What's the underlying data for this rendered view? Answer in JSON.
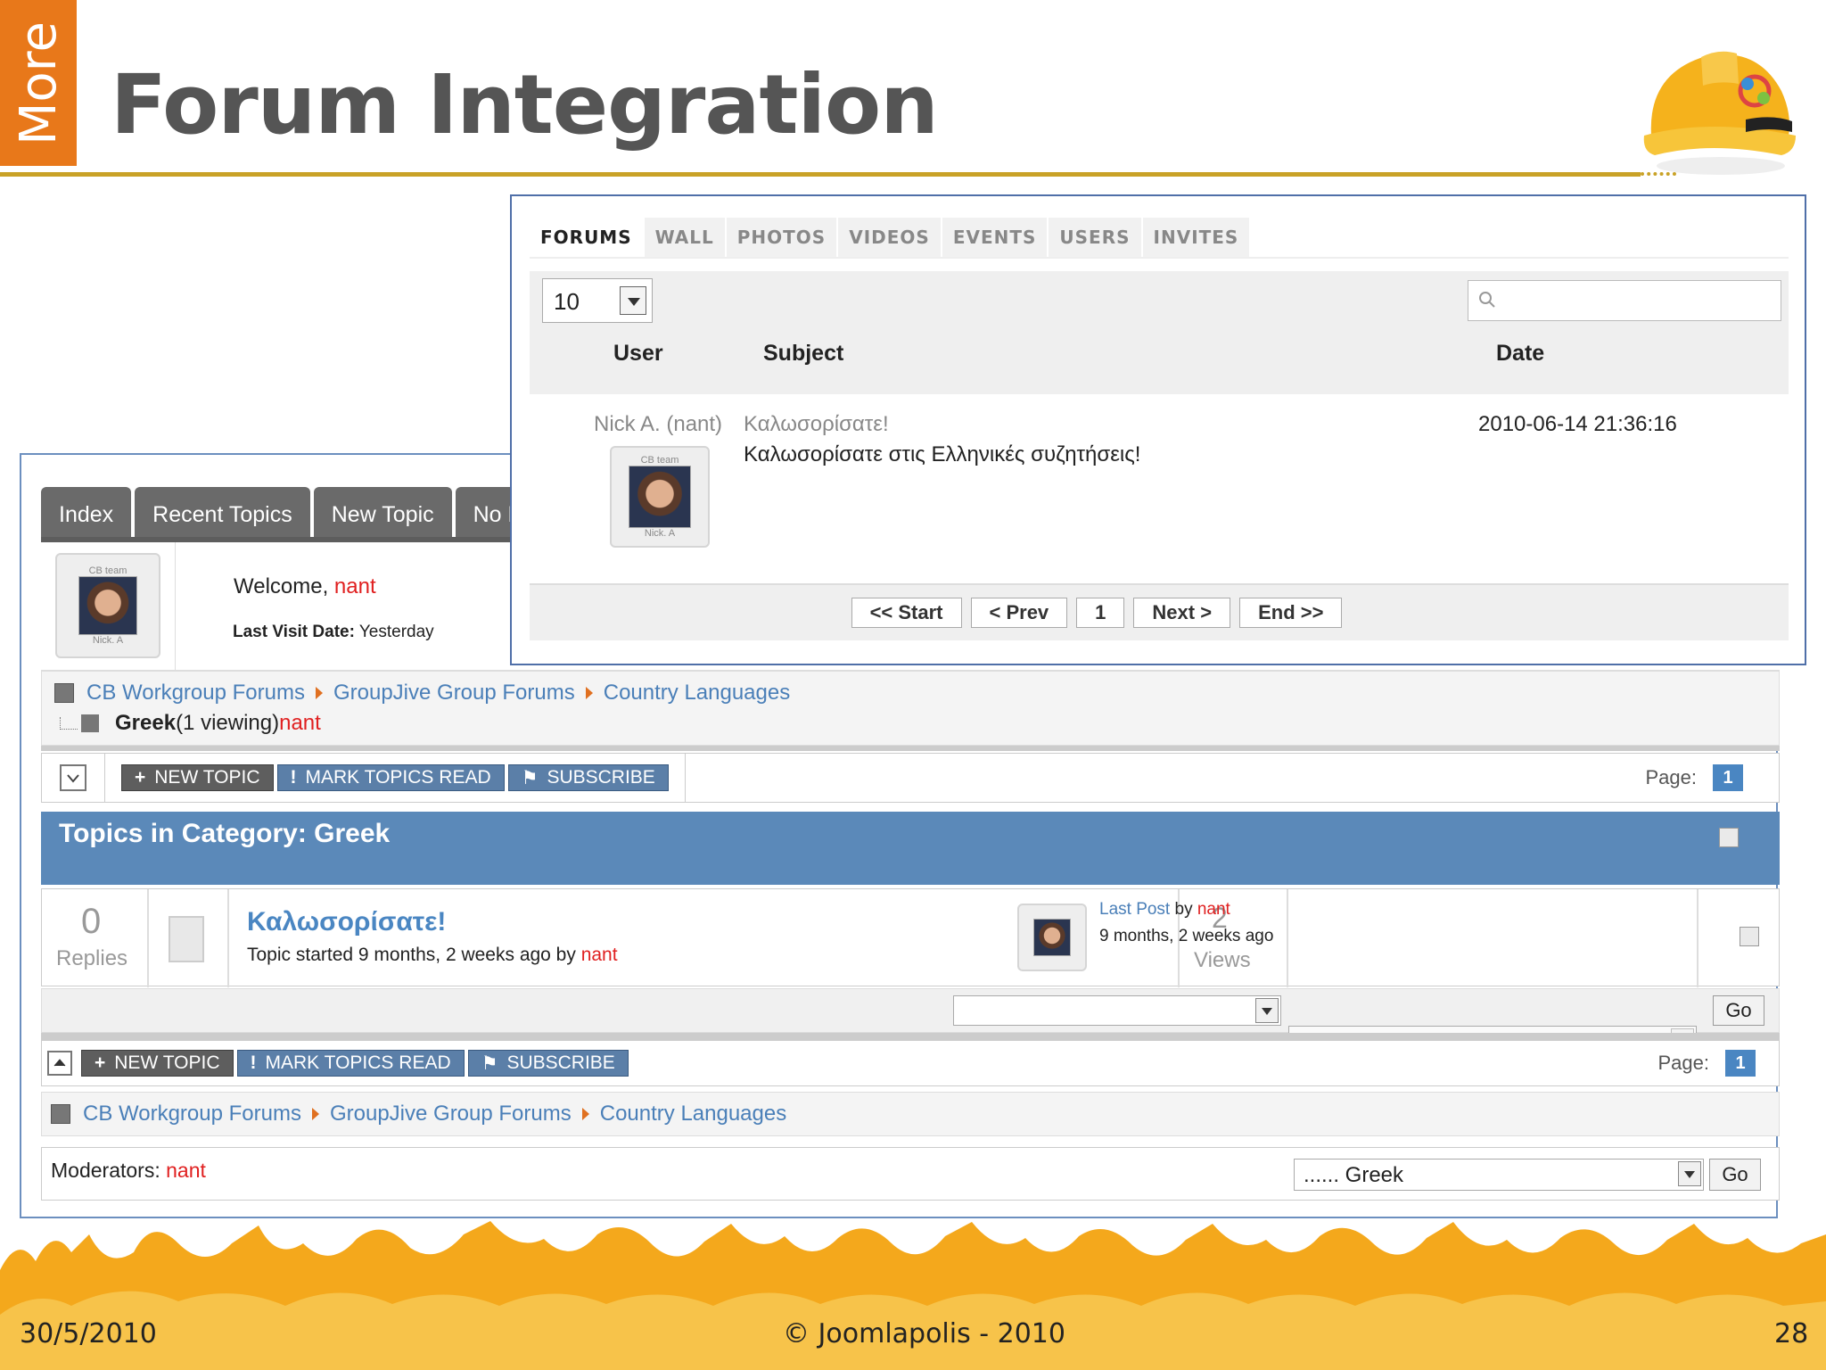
{
  "slide": {
    "side_tab": "More",
    "title": "Forum Integration",
    "footer_date": "30/5/2010",
    "footer_copyright": "© Joomlapolis - 2010",
    "footer_page": "28"
  },
  "forum": {
    "tabs": [
      "Index",
      "Recent Topics",
      "New Topic",
      "No F"
    ],
    "welcome_label": "Welcome, ",
    "welcome_user": "nant",
    "last_visit_label": "Last Visit Date:",
    "last_visit_value": " Yesterday",
    "avatar_caption": "Nick. A",
    "avatar_badge": "CB team",
    "breadcrumb": [
      "CB Workgroup Forums",
      "GroupJive Group Forums",
      "Country Languages"
    ],
    "current_forum": "Greek",
    "viewing": " (1 viewing) ",
    "viewing_user": "nant",
    "toolbar": {
      "new_topic": "NEW TOPIC",
      "mark_read": "MARK TOPICS READ",
      "subscribe": "SUBSCRIBE",
      "page_label": "Page:",
      "page_num": "1"
    },
    "category_header": "Topics in Category: Greek",
    "topic": {
      "replies": "0",
      "replies_label": "Replies",
      "title": "Καλωσορίσατε!",
      "meta": "Topic started 9 months, 2 weeks ago by ",
      "author": "nant",
      "views": "2",
      "views_label": "Views",
      "last_post_label": "Last Post",
      "by": " by ",
      "last_post_user": "nant",
      "last_post_time": "9 months, 2 weeks ago"
    },
    "go_label": "Go",
    "moderators_label": "Moderators: ",
    "moderators_user": "nant",
    "jump_select": "...... Greek"
  },
  "group": {
    "tabs": [
      "FORUMS",
      "WALL",
      "PHOTOS",
      "VIDEOS",
      "EVENTS",
      "USERS",
      "INVITES"
    ],
    "count_value": "10",
    "columns": {
      "user": "User",
      "subject": "Subject",
      "date": "Date"
    },
    "row": {
      "user": "Nick A. (nant)",
      "avatar_caption": "Nick. A",
      "avatar_badge": "CB team",
      "subject": "Καλωσορίσατε!",
      "body": "Καλωσορίσατε στις Ελληνικές συζητήσεις!",
      "date": "2010-06-14 21:36:16"
    },
    "pager": [
      "<< Start",
      "< Prev",
      "1",
      "Next >",
      "End >>"
    ]
  },
  "colors": {
    "accent_orange": "#e8781a",
    "rule_gold": "#c9a227",
    "forum_blue": "#5b89b9",
    "user_red": "#e02020"
  }
}
